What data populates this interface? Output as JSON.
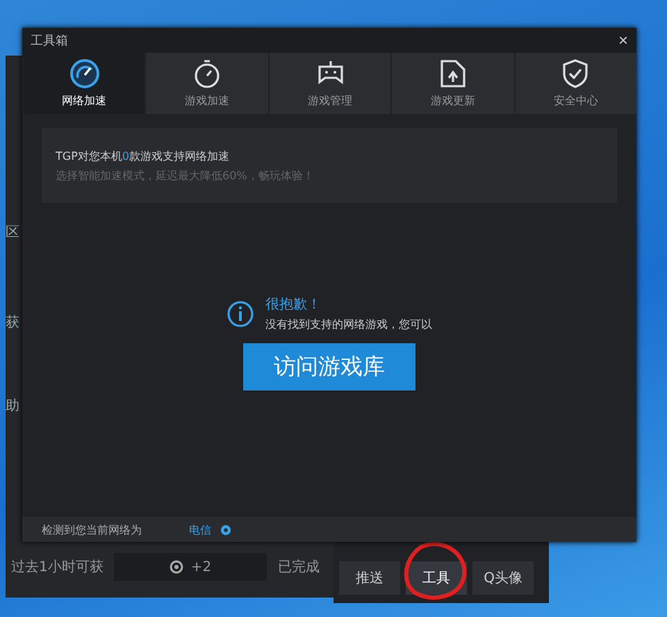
{
  "window": {
    "title": "工具箱",
    "close": "×"
  },
  "tabs": [
    {
      "label": "网络加速",
      "selected": true
    },
    {
      "label": "游戏加速",
      "selected": false
    },
    {
      "label": "游戏管理",
      "selected": false
    },
    {
      "label": "游戏更新",
      "selected": false
    },
    {
      "label": "安全中心",
      "selected": false
    }
  ],
  "notice": {
    "before": "TGP对您本机",
    "count": "0",
    "after": "款游戏支持网络加速",
    "subtitle": "选择智能加速模式，延迟最大降低60%，畅玩体验！"
  },
  "empty_state": {
    "title": "很抱歉！",
    "message": "没有找到支持的网络游戏，您可以",
    "button": "访问游戏库"
  },
  "footer": {
    "text": "检测到您当前网络为",
    "network": "电信"
  },
  "background_app": {
    "side_labels": [
      "区",
      "获",
      "助"
    ],
    "reward_label": "过去1小时可获",
    "reward_value": "+2",
    "status": "已完成",
    "buttons": [
      {
        "label": "推送",
        "selected": false
      },
      {
        "label": "工具",
        "selected": true
      },
      {
        "label": "Q头像",
        "selected": false
      }
    ]
  },
  "annotation": {
    "kind": "circle"
  }
}
